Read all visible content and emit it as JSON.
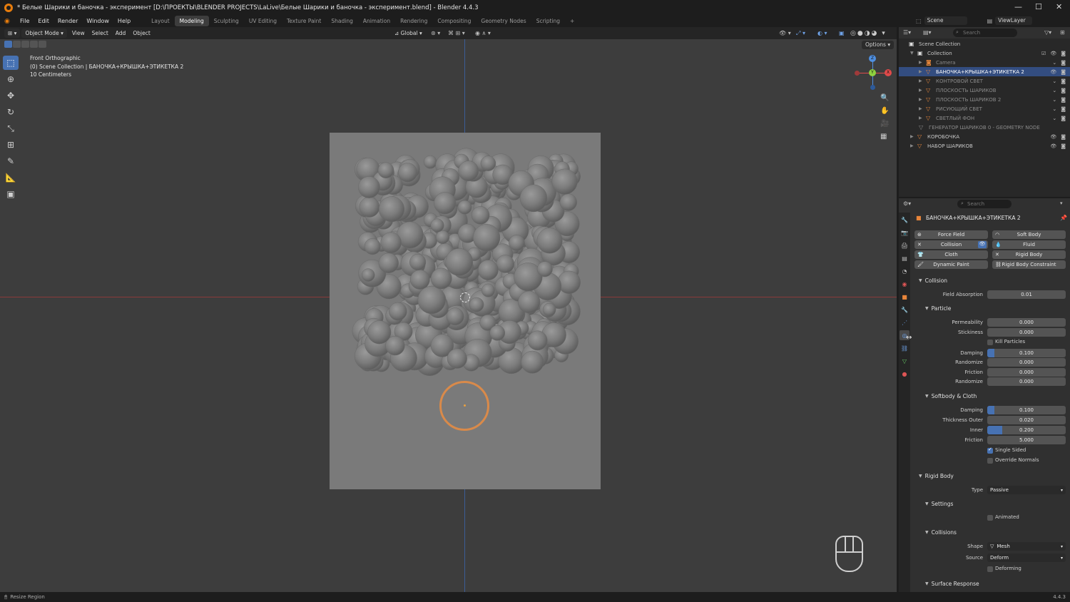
{
  "titlebar": {
    "title": "* Белые Шарики и баночка - эксперимент [D:\\ПРОЕКТЫ\\BLENDER PROJECTS\\LaLive\\Белые Шарики и баночка - эксперимент.blend] - Blender 4.4.3",
    "min": "—",
    "max": "☐",
    "close": "✕"
  },
  "menubar": {
    "items": [
      "File",
      "Edit",
      "Render",
      "Window",
      "Help"
    ],
    "workspaces": [
      "Layout",
      "Modeling",
      "Sculpting",
      "UV Editing",
      "Texture Paint",
      "Shading",
      "Animation",
      "Rendering",
      "Compositing",
      "Geometry Nodes",
      "Scripting"
    ],
    "active_workspace": "Modeling",
    "add_workspace": "+",
    "scene": "Scene",
    "view_layer": "ViewLayer"
  },
  "viewport": {
    "mode": "Object Mode",
    "menus": [
      "View",
      "Select",
      "Add",
      "Object"
    ],
    "transform_orientation": "Global",
    "options": "Options",
    "info_line1": "Front Orthographic",
    "info_line2": "(0) Scene Collection | БАНОЧКА+КРЫШКА+ЭТИКЕТКА 2",
    "info_line3": "10 Centimeters",
    "gizmo": {
      "x": "X",
      "y": "Y",
      "z": "Z"
    }
  },
  "outliner": {
    "search_placeholder": "Search",
    "root": "Scene Collection",
    "collection": "Collection",
    "items": [
      {
        "label": "Camera",
        "dim": true
      },
      {
        "label": "БАНОЧКА+КРЫШКА+ЭТИКЕТКА 2",
        "selected": true
      },
      {
        "label": "КОНТРОВОЙ СВЕТ",
        "dim": true
      },
      {
        "label": "ПЛОСКОСТЬ ШАРИКОВ",
        "dim": true
      },
      {
        "label": "ПЛОСКОСТЬ ШАРИКОВ 2",
        "dim": true
      },
      {
        "label": "РИСУЮЩИЙ СВЕТ",
        "dim": true
      },
      {
        "label": "СВЕТЛЫЙ ФОН",
        "dim": true
      }
    ],
    "top_items": [
      "ГЕНЕРАТОР ШАРИКОВ 0 - GEOMETRY NODE",
      "КОРОБОЧКА",
      "НАБОР ШАРИКОВ"
    ]
  },
  "properties": {
    "search_placeholder": "Search",
    "object_name": "БАНОЧКА+КРЫШКА+ЭТИКЕТКА 2",
    "physics_buttons": [
      "Force Field",
      "Soft Body",
      "Collision",
      "Fluid",
      "Cloth",
      "Rigid Body",
      "Dynamic Paint",
      "Rigid Body Constraint"
    ],
    "collision_header": "Collision",
    "field_absorption_label": "Field Absorption",
    "field_absorption": "0.01",
    "particle_header": "Particle",
    "permeability_label": "Permeability",
    "permeability": "0.000",
    "stickiness_label": "Stickiness",
    "stickiness": "0.000",
    "kill_particles": "Kill Particles",
    "damping_label": "Damping",
    "damping": "0.100",
    "randomize_label": "Randomize",
    "randomize": "0.000",
    "friction_label": "Friction",
    "friction": "0.000",
    "randomize2": "0.000",
    "softbody_header": "Softbody & Cloth",
    "sb_damping": "0.100",
    "thickness_outer_label": "Thickness Outer",
    "thickness_outer": "0.020",
    "inner_label": "Inner",
    "inner": "0.200",
    "sb_friction": "5.000",
    "single_sided": "Single Sided",
    "override_normals": "Override Normals",
    "rigid_body_header": "Rigid Body",
    "type_label": "Type",
    "type": "Passive",
    "settings_header": "Settings",
    "animated": "Animated",
    "collisions_header": "Collisions",
    "shape_label": "Shape",
    "shape": "Mesh",
    "source_label": "Source",
    "source": "Deform",
    "deforming": "Deforming",
    "surface_response_header": "Surface Response"
  },
  "statusbar": {
    "left": "Resize Region",
    "version": "4.4.3"
  },
  "colors": {
    "accent": "#4772b3",
    "selected_outline": "#e8853a",
    "x_axis": "#e04a4a",
    "y_axis": "#8fd13f",
    "z_axis": "#4f8fe0"
  }
}
